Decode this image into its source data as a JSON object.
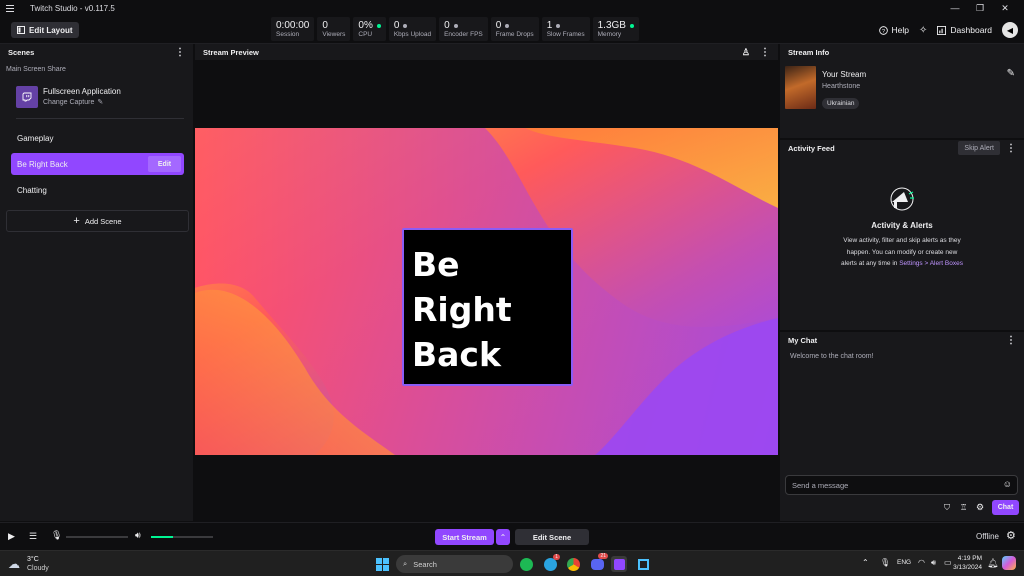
{
  "app": {
    "title": "Twitch Studio - v0.117.5"
  },
  "topbar": {
    "edit_layout": "Edit Layout",
    "stats": [
      {
        "value": "0:00:00",
        "label": "Session",
        "dot": ""
      },
      {
        "value": "0",
        "label": "Viewers",
        "dot": ""
      },
      {
        "value": "0%",
        "label": "CPU",
        "dot": "#00f593"
      },
      {
        "value": "0",
        "label": "Kbps Upload",
        "dot": "#adadb8"
      },
      {
        "value": "0",
        "label": "Encoder FPS",
        "dot": "#adadb8"
      },
      {
        "value": "0",
        "label": "Frame Drops",
        "dot": "#adadb8"
      },
      {
        "value": "1",
        "label": "Slow Frames",
        "dot": "#adadb8"
      },
      {
        "value": "1.3GB",
        "label": "Memory",
        "dot": "#00f593"
      }
    ],
    "help": "Help",
    "dashboard": "Dashboard"
  },
  "scenes": {
    "header": "Scenes",
    "group_label": "Main Screen Share",
    "source_title": "Fullscreen Application",
    "source_action": "Change Capture",
    "items": [
      {
        "label": "Gameplay"
      },
      {
        "label": "Be Right Back",
        "edit": "Edit"
      },
      {
        "label": "Chatting"
      }
    ],
    "add_scene": "Add Scene"
  },
  "preview": {
    "header": "Stream Preview",
    "brb_lines": [
      "Be",
      "Right",
      "Back"
    ]
  },
  "stream_info": {
    "header": "Stream Info",
    "title": "Your Stream",
    "category": "Hearthstone",
    "tag": "Ukrainian"
  },
  "activity": {
    "header": "Activity Feed",
    "skip_alert": "Skip Alert",
    "title": "Activity & Alerts",
    "body_1": "View activity, filter and skip alerts as they",
    "body_2": "happen. You can modify or create new",
    "body_3": "alerts at any time in",
    "link": "Settings > Alert Boxes"
  },
  "chat": {
    "header": "My Chat",
    "welcome": "Welcome to the chat room!",
    "placeholder": "Send a message",
    "chat_button": "Chat"
  },
  "bottom": {
    "start_stream": "Start Stream",
    "edit_scene": "Edit Scene",
    "status": "Offline",
    "mic_level": 0.0,
    "desktop_level": 0.35
  },
  "taskbar": {
    "weather_temp": "3°C",
    "weather_desc": "Cloudy",
    "search": "Search",
    "lang": "ENG",
    "time": "4:19 PM",
    "date": "3/13/2024",
    "badge_telegram": "1",
    "badge_discord": "21"
  },
  "colors": {
    "accent": "#9147ff",
    "bg": "#0e0e10",
    "panel": "#18181b",
    "good": "#00f593"
  }
}
